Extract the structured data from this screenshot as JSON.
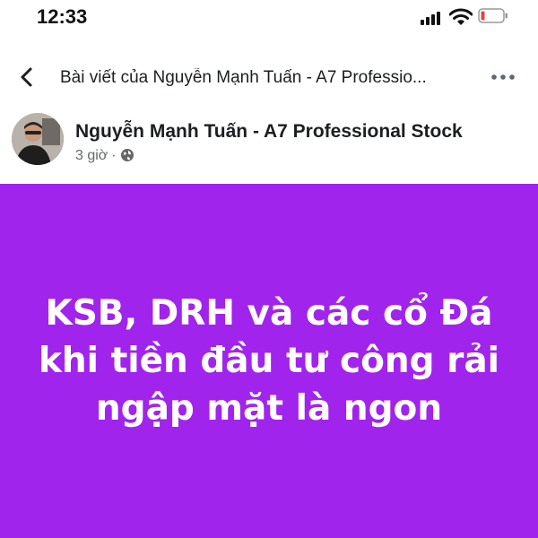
{
  "status_bar": {
    "time": "12:33",
    "icons": [
      "cellular-signal-icon",
      "wifi-icon",
      "battery-low-icon"
    ],
    "battery_color": "#e0453a"
  },
  "header": {
    "back_icon": "chevron-left-icon",
    "title": "Bài viết của Nguyễn Mạnh Tuấn - A7 Professio...",
    "more_icon": "more-horizontal-icon"
  },
  "post": {
    "author": "Nguyễn Mạnh Tuấn - A7 Professional Stock",
    "time_ago": "3 giờ",
    "separator": "·",
    "privacy_icon": "globe-icon",
    "background_color": "#a024ec",
    "text_lines": [
      "KSB, DRH và các cổ Đá",
      "khi tiền đầu tư công rải",
      "ngập mặt là ngon"
    ]
  }
}
